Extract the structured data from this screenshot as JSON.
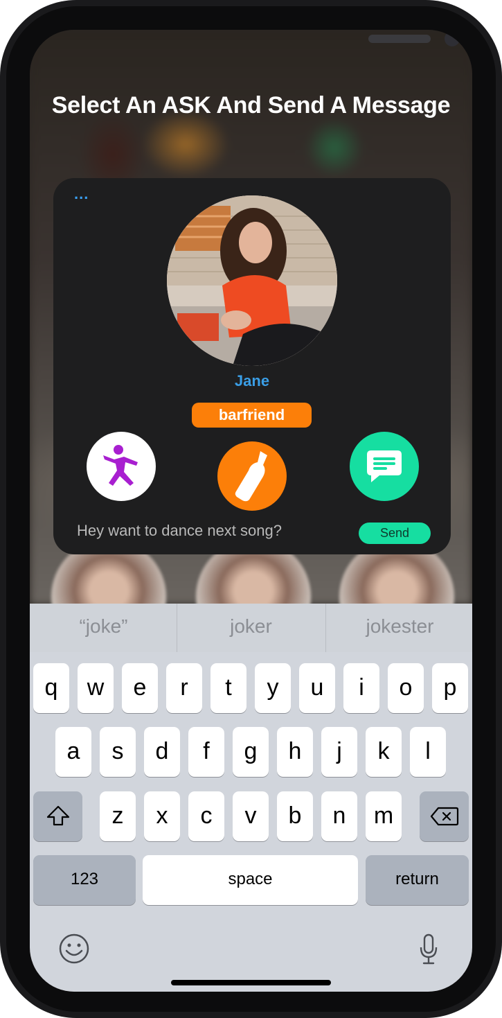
{
  "header": {
    "title": "Select An ASK And Send A Message"
  },
  "card": {
    "menu_dots": "...",
    "profile_name": "Jane",
    "badge_label": "barfriend",
    "actions": [
      {
        "name": "dance",
        "icon": "dancing-person-icon",
        "color": "#a81fd0"
      },
      {
        "name": "drink",
        "icon": "bottle-icon",
        "color": "#fc7f09"
      },
      {
        "name": "message",
        "icon": "chat-bubble-icon",
        "color": "#16dea1"
      }
    ],
    "message_text": "Hey want to dance next song?",
    "send_label": "Send"
  },
  "keyboard": {
    "suggestions": [
      "“joke”",
      "joker",
      "jokester"
    ],
    "row1": [
      "q",
      "w",
      "e",
      "r",
      "t",
      "y",
      "u",
      "i",
      "o",
      "p"
    ],
    "row2": [
      "a",
      "s",
      "d",
      "f",
      "g",
      "h",
      "j",
      "k",
      "l"
    ],
    "row3": [
      "z",
      "x",
      "c",
      "v",
      "b",
      "n",
      "m"
    ],
    "numbers_label": "123",
    "space_label": "space",
    "return_label": "return"
  },
  "colors": {
    "accent_blue": "#3a9ee6",
    "orange": "#fc7f09",
    "green": "#16dea1",
    "purple": "#a81fd0"
  }
}
